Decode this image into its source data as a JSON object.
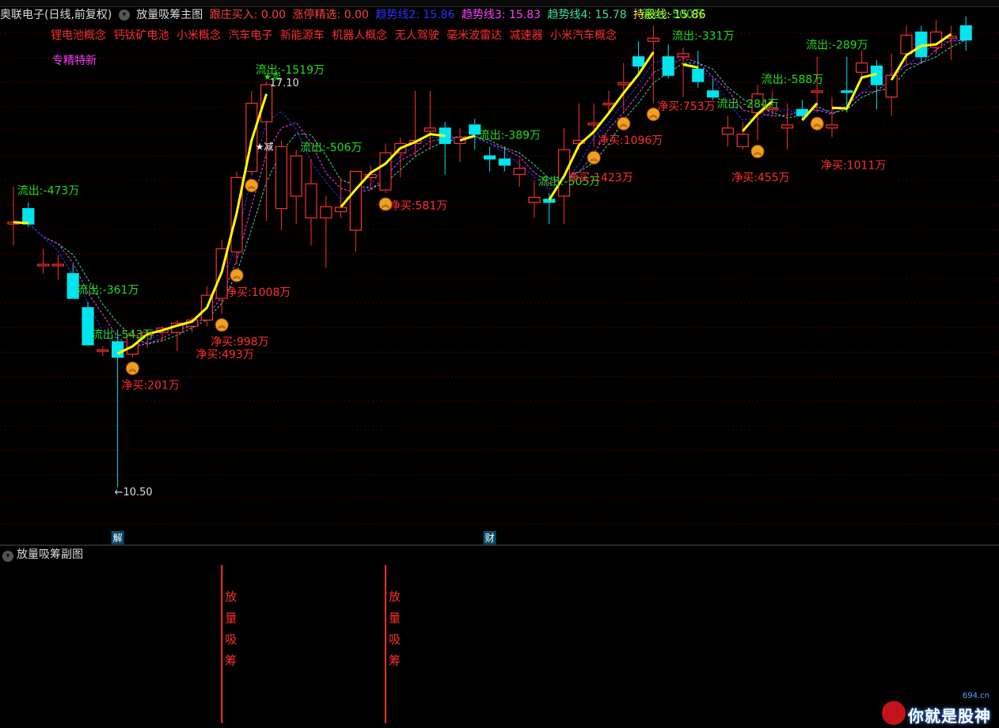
{
  "header": {
    "stock_name": "奥联电子(日线,前复权)",
    "indicator_name": "放量吸筹主图",
    "items": [
      {
        "label": "跟庄买入: 0.00",
        "color": "#ff4040"
      },
      {
        "label": "涨停精选: 0.00",
        "color": "#ff4040"
      },
      {
        "label": "趋势线2: 15.86",
        "color": "#3030ff"
      },
      {
        "label": "趋势线3: 15.83",
        "color": "#ff40ff"
      },
      {
        "label": "趋势线4: 15.78",
        "color": "#40e0a0"
      },
      {
        "label": "持股线: 15.86",
        "color": "#ffff40"
      }
    ]
  },
  "concepts": [
    "锂电池概念",
    "钙钛矿电池",
    "小米概念",
    "汽车电子",
    "新能源车",
    "机器人概念",
    "无人驾驶",
    "毫米波雷达",
    "减速器",
    "小米汽车概念"
  ],
  "special_tag": "专精特新",
  "sub_chart": {
    "title": "放量吸筹副图",
    "signal_text": [
      "放",
      "量",
      "吸",
      "筹"
    ]
  },
  "colors": {
    "up": "#ff3030",
    "down": "#00e5ee",
    "hold_line": "#ffff00",
    "trend2": "#3030ff",
    "trend3": "#ff40ff",
    "trend4": "#40e0a0",
    "outflow": "#22dd22",
    "netbuy": "#ff3030",
    "grid": "#5a0000"
  },
  "chart_data": {
    "type": "candlestick",
    "ylim": [
      10.0,
      17.6
    ],
    "candles": [
      {
        "o": 14.75,
        "h": 15.35,
        "l": 14.4,
        "c": 14.78
      },
      {
        "o": 15.0,
        "h": 15.1,
        "l": 14.7,
        "c": 14.75
      },
      {
        "o": 14.1,
        "h": 14.35,
        "l": 13.95,
        "c": 14.1
      },
      {
        "o": 14.1,
        "h": 14.25,
        "l": 13.85,
        "c": 14.1
      },
      {
        "o": 13.95,
        "h": 14.1,
        "l": 13.55,
        "c": 13.55
      },
      {
        "o": 13.4,
        "h": 13.5,
        "l": 12.8,
        "c": 12.8
      },
      {
        "o": 12.72,
        "h": 12.78,
        "l": 12.62,
        "c": 12.72
      },
      {
        "o": 12.85,
        "h": 13.05,
        "l": 10.5,
        "c": 12.6
      },
      {
        "o": 12.65,
        "h": 13.05,
        "l": 12.6,
        "c": 12.95
      },
      {
        "o": 12.95,
        "h": 13.05,
        "l": 12.75,
        "c": 13.0
      },
      {
        "o": 13.0,
        "h": 13.1,
        "l": 12.85,
        "c": 13.07
      },
      {
        "o": 13.0,
        "h": 13.2,
        "l": 12.7,
        "c": 13.15
      },
      {
        "o": 13.1,
        "h": 13.25,
        "l": 13.0,
        "c": 13.2
      },
      {
        "o": 13.2,
        "h": 13.75,
        "l": 13.1,
        "c": 13.6
      },
      {
        "o": 13.55,
        "h": 14.5,
        "l": 13.3,
        "c": 14.35
      },
      {
        "o": 14.3,
        "h": 15.6,
        "l": 14.1,
        "c": 15.5
      },
      {
        "o": 15.6,
        "h": 16.9,
        "l": 15.55,
        "c": 16.7
      },
      {
        "o": 16.4,
        "h": 17.05,
        "l": 14.8,
        "c": 17.0
      },
      {
        "o": 15.0,
        "h": 16.1,
        "l": 14.65,
        "c": 16.0
      },
      {
        "o": 15.2,
        "h": 15.95,
        "l": 14.75,
        "c": 15.85
      },
      {
        "o": 14.85,
        "h": 15.8,
        "l": 14.4,
        "c": 15.4
      },
      {
        "o": 14.85,
        "h": 15.2,
        "l": 14.05,
        "c": 15.03
      },
      {
        "o": 14.95,
        "h": 15.5,
        "l": 14.85,
        "c": 15.02
      },
      {
        "o": 14.65,
        "h": 15.4,
        "l": 14.3,
        "c": 15.6
      },
      {
        "o": 15.5,
        "h": 15.7,
        "l": 15.3,
        "c": 15.55
      },
      {
        "o": 15.3,
        "h": 16.05,
        "l": 15.25,
        "c": 15.9
      },
      {
        "o": 15.9,
        "h": 16.15,
        "l": 15.5,
        "c": 16.05
      },
      {
        "o": 16.05,
        "h": 16.9,
        "l": 15.85,
        "c": 16.1
      },
      {
        "o": 16.25,
        "h": 16.9,
        "l": 15.95,
        "c": 16.3
      },
      {
        "o": 16.3,
        "h": 16.4,
        "l": 15.55,
        "c": 16.05
      },
      {
        "o": 16.05,
        "h": 16.3,
        "l": 15.75,
        "c": 16.15
      },
      {
        "o": 16.35,
        "h": 16.45,
        "l": 15.95,
        "c": 16.2
      },
      {
        "o": 15.85,
        "h": 16.0,
        "l": 15.6,
        "c": 15.8
      },
      {
        "o": 15.8,
        "h": 16.0,
        "l": 15.6,
        "c": 15.7
      },
      {
        "o": 15.55,
        "h": 15.8,
        "l": 15.35,
        "c": 15.65
      },
      {
        "o": 15.1,
        "h": 15.45,
        "l": 14.85,
        "c": 15.18
      },
      {
        "o": 15.15,
        "h": 15.25,
        "l": 14.75,
        "c": 15.1
      },
      {
        "o": 15.2,
        "h": 16.3,
        "l": 14.75,
        "c": 15.95
      },
      {
        "o": 16.05,
        "h": 16.7,
        "l": 15.95,
        "c": 16.1
      },
      {
        "o": 16.35,
        "h": 16.7,
        "l": 16.0,
        "c": 16.38
      },
      {
        "o": 16.7,
        "h": 16.9,
        "l": 16.55,
        "c": 16.7
      },
      {
        "o": 17.0,
        "h": 17.35,
        "l": 16.55,
        "c": 17.03
      },
      {
        "o": 17.45,
        "h": 17.7,
        "l": 17.15,
        "c": 17.3
      },
      {
        "o": 17.7,
        "h": 17.95,
        "l": 16.7,
        "c": 17.75
      },
      {
        "o": 17.45,
        "h": 17.65,
        "l": 17.1,
        "c": 17.15
      },
      {
        "o": 17.45,
        "h": 17.6,
        "l": 16.8,
        "c": 17.5
      },
      {
        "o": 17.25,
        "h": 17.55,
        "l": 16.95,
        "c": 17.05
      },
      {
        "o": 16.9,
        "h": 17.1,
        "l": 16.75,
        "c": 16.8
      },
      {
        "o": 16.2,
        "h": 16.5,
        "l": 16.0,
        "c": 16.3
      },
      {
        "o": 16.0,
        "h": 16.4,
        "l": 15.95,
        "c": 16.2
      },
      {
        "o": 16.55,
        "h": 17.0,
        "l": 16.1,
        "c": 16.85
      },
      {
        "o": 16.6,
        "h": 16.9,
        "l": 16.5,
        "c": 16.62
      },
      {
        "o": 16.3,
        "h": 16.7,
        "l": 15.95,
        "c": 16.35
      },
      {
        "o": 16.6,
        "h": 16.75,
        "l": 16.45,
        "c": 16.5
      },
      {
        "o": 16.9,
        "h": 17.45,
        "l": 16.55,
        "c": 16.9
      },
      {
        "o": 16.3,
        "h": 16.8,
        "l": 16.15,
        "c": 16.35
      },
      {
        "o": 16.9,
        "h": 17.45,
        "l": 16.55,
        "c": 16.88
      },
      {
        "o": 17.2,
        "h": 17.55,
        "l": 17.1,
        "c": 17.35
      },
      {
        "o": 17.3,
        "h": 17.4,
        "l": 16.6,
        "c": 17.0
      },
      {
        "o": 16.8,
        "h": 17.5,
        "l": 16.5,
        "c": 17.15
      },
      {
        "o": 17.5,
        "h": 17.95,
        "l": 17.3,
        "c": 17.8
      },
      {
        "o": 17.85,
        "h": 17.95,
        "l": 17.35,
        "c": 17.45
      },
      {
        "o": 17.6,
        "h": 18.05,
        "l": 17.5,
        "c": 17.85
      },
      {
        "o": 17.75,
        "h": 17.95,
        "l": 17.4,
        "c": 17.78
      },
      {
        "o": 17.95,
        "h": 18.1,
        "l": 17.55,
        "c": 17.72
      }
    ],
    "flow_labels": [
      {
        "text": "流出:-473万",
        "type": "out",
        "candle": 1
      },
      {
        "text": "流出:-361万",
        "type": "out",
        "candle": 5
      },
      {
        "text": "流出:-543万",
        "type": "out",
        "candle": 6
      },
      {
        "text": "净买:201万",
        "type": "buy",
        "candle": 8
      },
      {
        "text": "净买:493万",
        "type": "buy",
        "candle": 13
      },
      {
        "text": "净买:998万",
        "type": "buy",
        "candle": 14
      },
      {
        "text": "净买:1008万",
        "type": "buy",
        "candle": 15
      },
      {
        "text": "流出:-1519万",
        "type": "out",
        "candle": 17
      },
      {
        "text": "流出:-506万",
        "type": "out",
        "candle": 20
      },
      {
        "text": "净买:581万",
        "type": "buy",
        "candle": 26
      },
      {
        "text": "流出:-389万",
        "type": "out",
        "candle": 32
      },
      {
        "text": "流出:-505万",
        "type": "out",
        "candle": 36
      },
      {
        "text": "净买:1423万",
        "type": "buy",
        "candle": 38
      },
      {
        "text": "净买:1096万",
        "type": "buy",
        "candle": 40
      },
      {
        "text": "流出:-500万",
        "type": "out",
        "candle": 43
      },
      {
        "text": "流出:-331万",
        "type": "out",
        "candle": 45
      },
      {
        "text": "净买:753万",
        "type": "buy",
        "candle": 44
      },
      {
        "text": "流出:-284万",
        "type": "out",
        "candle": 48
      },
      {
        "text": "净买:455万",
        "type": "buy",
        "candle": 49
      },
      {
        "text": "流出:-588万",
        "type": "out",
        "candle": 51
      },
      {
        "text": "流出:-289万",
        "type": "out",
        "candle": 54
      },
      {
        "text": "净买:1011万",
        "type": "buy",
        "candle": 55
      }
    ],
    "annotations": {
      "high_label": "17.10",
      "low_label": "←10.50",
      "sell_star": "★卖",
      "reduce_star": "★减",
      "event_markers": [
        {
          "text": "解",
          "candle": 7
        },
        {
          "text": "财",
          "candle": 32
        }
      ]
    },
    "buy_signals": [
      8,
      14,
      15,
      16,
      25,
      39,
      41,
      43,
      50,
      54
    ],
    "sub_signals_candles": [
      14,
      25
    ]
  }
}
